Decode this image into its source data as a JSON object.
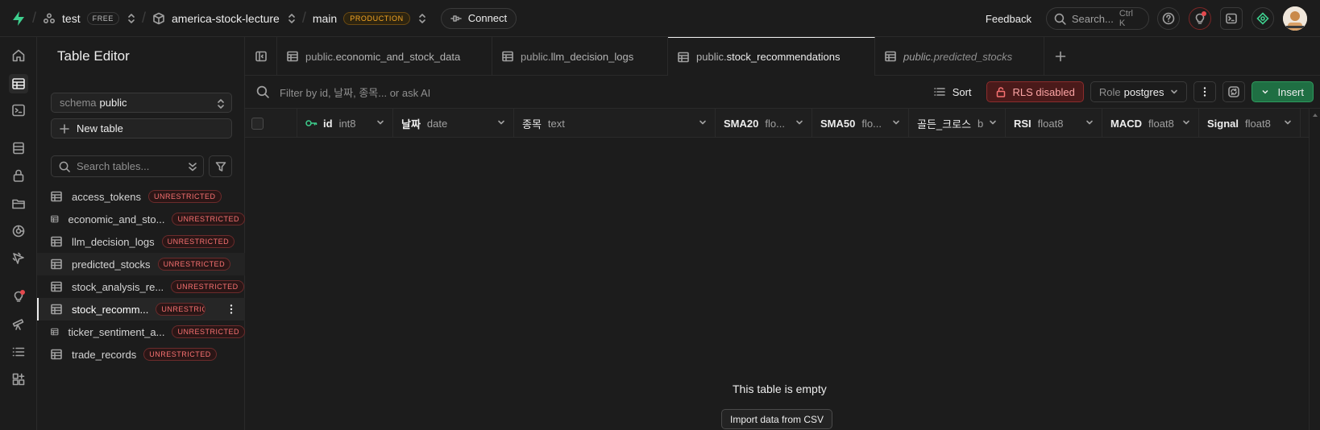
{
  "topbar": {
    "org_name": "test",
    "org_badge": "FREE",
    "project_name": "america-stock-lecture",
    "branch_name": "main",
    "branch_badge": "PRODUCTION",
    "connect_label": "Connect",
    "feedback_label": "Feedback",
    "search_placeholder": "Search...",
    "search_shortcut": "Ctrl K"
  },
  "sidebar": {
    "title": "Table Editor",
    "schema_label": "schema",
    "schema_value": "public",
    "new_table_label": "New table",
    "search_placeholder": "Search tables...",
    "tables": [
      {
        "name": "access_tokens",
        "badge": "UNRESTRICTED"
      },
      {
        "name": "economic_and_sto...",
        "badge": "UNRESTRICTED"
      },
      {
        "name": "llm_decision_logs",
        "badge": "UNRESTRICTED"
      },
      {
        "name": "predicted_stocks",
        "badge": "UNRESTRICTED"
      },
      {
        "name": "stock_analysis_re...",
        "badge": "UNRESTRICTED"
      },
      {
        "name": "stock_recomm...",
        "badge": "UNRESTRICTED"
      },
      {
        "name": "ticker_sentiment_a...",
        "badge": "UNRESTRICTED"
      },
      {
        "name": "trade_records",
        "badge": "UNRESTRICTED"
      }
    ]
  },
  "tabs": [
    {
      "schema": "public.",
      "name": "economic_and_stock_data"
    },
    {
      "schema": "public.",
      "name": "llm_decision_logs"
    },
    {
      "schema": "public.",
      "name": "stock_recommendations"
    },
    {
      "schema": "public.",
      "name": "predicted_stocks"
    }
  ],
  "toolbar": {
    "filter_placeholder": "Filter by id, 날짜, 종목... or ask AI",
    "sort_label": "Sort",
    "rls_label": "RLS disabled",
    "role_label": "Role",
    "role_value": "postgres",
    "insert_label": "Insert"
  },
  "columns": [
    {
      "name": "id",
      "type": "int8"
    },
    {
      "name": "날짜",
      "type": "date"
    },
    {
      "name": "종목",
      "type": "text"
    },
    {
      "name": "SMA20",
      "type": "flo..."
    },
    {
      "name": "SMA50",
      "type": "flo..."
    },
    {
      "name": "골든_크로스",
      "type": "b"
    },
    {
      "name": "RSI",
      "type": "float8"
    },
    {
      "name": "MACD",
      "type": "float8"
    },
    {
      "name": "Signal",
      "type": "float8"
    }
  ],
  "empty_state": {
    "message": "This table is empty",
    "import_label": "Import data from CSV"
  },
  "colors": {
    "background": "#1c1c1c",
    "brand_green": "#3ecf8e",
    "insert_green": "#1f6f43",
    "rls_red": "#4a1a1a",
    "production_amber": "#f5a623",
    "unrestricted_red": "#f87171"
  }
}
